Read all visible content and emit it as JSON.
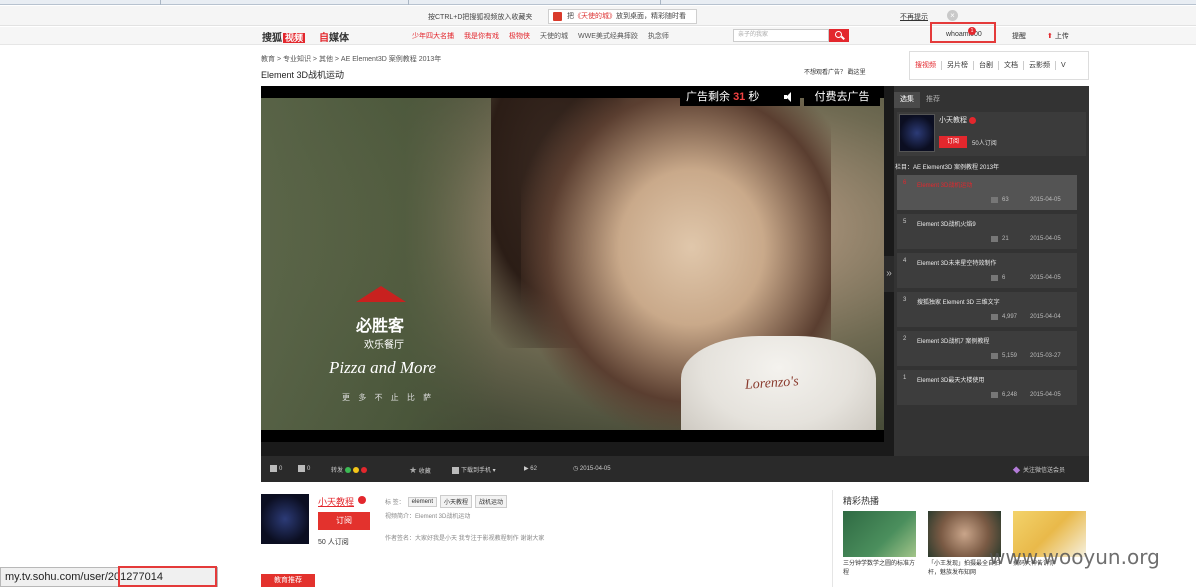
{
  "notice": {
    "text": "按CTRL+D把搜狐视频放入收藏夹",
    "pill_prefix": "把",
    "pill_highlight": "《天使的城》",
    "pill_suffix": "放到桌面，精彩随时看",
    "dont_show": "不再提示"
  },
  "nav": {
    "logo_a": "搜狐",
    "logo_b": "视频",
    "logo2_a": "自",
    "logo2_b": "媒体",
    "links": [
      "少年四大名捕",
      "我是你有戏",
      "极物侠",
      "天使的城",
      "WWE美式经典摔跤",
      "执念师"
    ],
    "search_placeholder": "亲子的我家",
    "user": "whoami000",
    "user_badge": "1",
    "msg": "提醒",
    "upload": "上传"
  },
  "page": {
    "breadcrumb": "教育 > 专业知识 > 其他 > AE Element3D 案例教程 2013年",
    "title": "Element 3D战机运动",
    "ad_question": "不想观看广告？ 戳这里"
  },
  "mini_tabs": [
    "搜视频",
    "另片榜",
    "台剧",
    "文档",
    "云影频",
    "V"
  ],
  "player": {
    "ad_prefix": "广告剩余",
    "ad_seconds": "31",
    "ad_suffix": "秒",
    "ad_pay": "付费去广告",
    "video_brand_cn": "必胜客",
    "video_brand_sub": "欢乐餐厅",
    "video_brand_en": "Pizza and More",
    "video_brand_small": "更 多 不 止 比 萨",
    "cup_brand": "Lorenzo's",
    "expand_glyph": "»"
  },
  "side": {
    "tabs": [
      "选集",
      "推荐"
    ],
    "uploader": "小天教程",
    "subscribe": "订阅",
    "subs_count": "50",
    "subs_suffix": "人订阅",
    "column": "栏目：AE Element3D 案例教程 2013年",
    "episodes": [
      {
        "num": "6",
        "title": "Element 3D战机运动",
        "plays": "63",
        "date": "2015-04-05",
        "current": true
      },
      {
        "num": "5",
        "title": "Element 3D战机火焰9",
        "plays": "21",
        "date": "2015-04-05",
        "current": false
      },
      {
        "num": "4",
        "title": "Element 3D未来星空特效制作",
        "plays": "6",
        "date": "2015-04-05",
        "current": false
      },
      {
        "num": "3",
        "title": "搜狐独家 Element 3D 三维文字",
        "plays": "4,997",
        "date": "2015-04-04",
        "current": false
      },
      {
        "num": "2",
        "title": "Element 3D战机7 案例教程",
        "plays": "5,159",
        "date": "2015-03-27",
        "current": false
      },
      {
        "num": "1",
        "title": "Element 3D最天大楼使用",
        "plays": "6,248",
        "date": "2015-04-05",
        "current": false
      }
    ]
  },
  "controls": {
    "likes": "0",
    "dislikes": "0",
    "share": "转发",
    "collect": "收藏",
    "download": "下载到手机",
    "plays": "62",
    "date": "2015-04-05",
    "wechat": "关注微信送会员"
  },
  "below": {
    "uploader": "小天教程",
    "subscribe": "订阅",
    "subs": "50 人订阅",
    "tags_label": "标  签：",
    "tags": [
      "element",
      "小天教程",
      "战机运动"
    ],
    "intro": "视频简介：Element 3D战机运动",
    "author": "作者签名：大家好我是小天 我专注于影视教程制作 谢谢大家",
    "edu_rec": "教育推荐",
    "hot_title": "精彩热播",
    "hot": [
      {
        "caption": "三分钟学数学之圆的标准方程"
      },
      {
        "caption": "「小王发现」拍摄最全自拍杆，魅族发布知网"
      },
      {
        "caption": "搞码大神告诉你"
      }
    ]
  },
  "status": {
    "url": "my.tv.sohu.com/user/201277014"
  },
  "watermark": "www.wooyun.org",
  "colors": {
    "accent": "#e3272d",
    "highlight_box": "#e43a3a"
  }
}
